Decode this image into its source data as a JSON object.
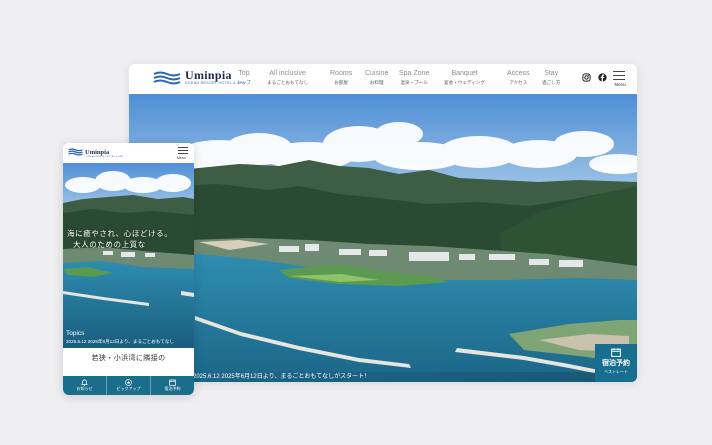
{
  "brand": {
    "name": "Uminpia",
    "sub": "OCEAN RESORT HOTEL & SPA"
  },
  "nav": [
    {
      "en": "Top",
      "jp": "トップ"
    },
    {
      "en": "All inclusive",
      "jp": "まるごとおもてなし"
    },
    {
      "en": "Rooms",
      "jp": "お部屋"
    },
    {
      "en": "Cuisine",
      "jp": "お料理"
    },
    {
      "en": "Spa Zone",
      "jp": "温泉・プール"
    },
    {
      "en": "Banquet",
      "jp": "宴会・ウェディング"
    },
    {
      "en": "Access",
      "jp": "アクセス"
    },
    {
      "en": "Stay",
      "jp": "過ごし方"
    }
  ],
  "icons": {
    "instagram": "instagram-icon",
    "facebook": "facebook-icon",
    "menu": "hamburger-menu-icon",
    "calendar": "calendar-icon"
  },
  "menu_label": "Menu",
  "desktop": {
    "news_text": "2025.6.12 2025年6月12日より、まるごとおもてなしがスタート！",
    "reserve": {
      "title": "宿泊予約",
      "sub": "ベストレート"
    }
  },
  "mobile": {
    "brand_sub": "OCEAN RESORT HOTEL & SPA",
    "catch_line1": "海に癒やされ、心ほどける。",
    "catch_line2": "大人のための上質な",
    "topics_title": "Topics",
    "topics_text": "2025.6.12 2025年6月12日より、まるごとおもてなし",
    "body_text": "若狭・小浜湾に隣接の",
    "tabs": [
      {
        "label": "お知らせ",
        "icon": "bell-icon"
      },
      {
        "label": "ピックアップ",
        "icon": "star-icon"
      },
      {
        "label": "宿泊予約",
        "icon": "calendar-icon"
      }
    ]
  },
  "colors": {
    "accent": "#176e8e",
    "sea": "#2a86a8",
    "sky": "#5b95d6",
    "mountain": "#2f4d33"
  }
}
